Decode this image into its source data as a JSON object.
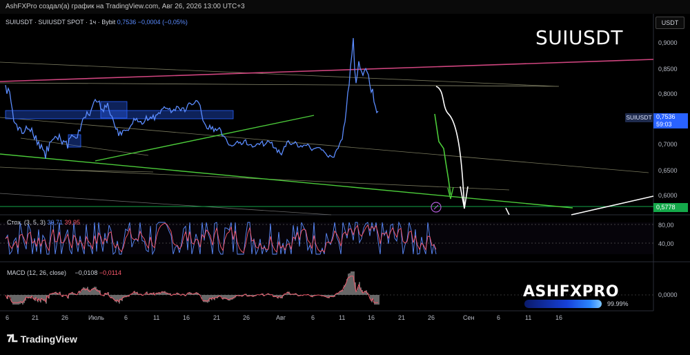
{
  "header": {
    "publish_info": "AshFXPro создал(а) график на TradingView.com, Авг 26, 2026 13:00 UTC+3"
  },
  "legend": {
    "symbol_line": "SUIUSDT · SUIUSDT SPOT · 1ч · Bybit",
    "last": "0,7536",
    "change": "−0,0004 (−0,05%)"
  },
  "symbol_title": "SUIUSDT",
  "currency_button": "USDT",
  "price_tag": {
    "symbol": "SUIUSDT",
    "price": "0,7536",
    "countdown": "59:03"
  },
  "green_tag": "0,5778",
  "stoch_legend": {
    "name": "Стох. (3, 5, 3)",
    "k": "30,71",
    "d": "39,95"
  },
  "macd_legend": {
    "name": "MACD (12, 26, close)",
    "macd": "−0,0108",
    "signal": "−0,0114"
  },
  "brand": {
    "name": "ASHFXPRO",
    "percent": "99.99%"
  },
  "footer": {
    "logo_text": "TradingView"
  },
  "colors": {
    "price_line": "#5b8cff",
    "accent_blue": "#2962ff",
    "green_level": "#14a84a",
    "trend_green": "#4ccc3a",
    "magenta_line": "#d0457f",
    "stoch_k": "#5b8cff",
    "stoch_d": "#ff5a6e",
    "macd_hist": "#8a8a8a"
  },
  "chart_data": [
    {
      "type": "line",
      "name": "price",
      "series_name": "SUIUSDT",
      "price_axis_ticks": [
        "0,9000",
        "0,8500",
        "0,8000",
        "0,7500",
        "0,7000",
        "0,6500",
        "0,6000"
      ],
      "ylim": [
        0.57,
        0.955
      ],
      "time_axis_labels": [
        "6",
        "21",
        "26",
        "Июль",
        "6",
        "11",
        "16",
        "21",
        "26",
        "Авг",
        "6",
        "11",
        "16",
        "21",
        "26",
        "Сен",
        "6",
        "11",
        "16"
      ],
      "x": [
        0,
        2,
        4,
        6,
        8,
        10,
        12,
        14,
        16,
        18,
        20,
        22,
        24,
        26,
        28,
        30,
        32,
        34,
        36,
        38,
        40,
        42,
        44,
        46,
        48,
        50,
        52,
        54,
        56,
        58,
        60,
        62,
        64,
        66,
        68,
        70,
        72,
        74,
        76,
        78,
        80,
        82,
        84,
        86,
        88,
        90,
        92,
        94,
        96,
        98,
        100,
        102,
        104,
        106,
        108,
        110,
        112,
        114,
        116,
        118,
        120,
        122,
        124,
        126,
        128,
        130,
        132,
        134,
        136,
        138,
        140,
        142,
        144,
        146,
        148,
        150,
        152,
        154,
        156,
        158,
        160,
        162,
        164,
        166,
        168,
        170,
        172,
        174,
        176,
        178,
        180,
        182,
        184,
        186,
        188,
        190,
        192,
        194,
        196,
        198,
        200,
        202,
        204,
        206,
        208,
        210,
        212,
        214,
        216,
        218,
        220,
        222,
        224,
        226,
        228,
        230,
        232,
        234,
        236,
        238,
        240,
        242,
        244,
        246,
        248,
        250,
        252,
        254,
        256,
        258,
        260,
        262,
        264,
        266,
        268,
        270,
        272,
        274,
        276,
        278,
        280,
        282,
        284,
        286,
        288,
        290,
        292,
        294,
        296,
        298,
        300,
        302,
        304,
        306,
        308,
        310,
        312,
        314,
        316,
        318,
        320,
        322,
        324,
        326,
        328,
        330,
        332,
        334,
        336,
        338,
        340,
        342,
        344,
        346,
        348,
        350,
        352,
        354,
        356,
        358,
        360,
        362,
        364,
        366,
        368,
        370,
        372,
        374,
        376,
        378,
        380,
        382,
        384,
        386,
        388,
        390,
        392,
        394,
        396,
        398,
        400,
        402,
        404,
        406,
        408,
        410,
        412,
        414,
        416,
        418,
        420,
        422,
        424,
        426,
        428,
        430,
        432,
        434,
        436,
        438,
        440,
        442,
        444,
        446,
        448,
        450,
        452,
        454,
        456,
        458,
        460,
        462,
        464,
        466,
        468,
        470,
        472,
        474,
        476,
        478,
        480,
        482,
        484,
        486,
        488,
        490,
        492,
        494,
        496,
        498,
        500,
        502,
        504,
        506,
        508,
        510,
        512,
        514,
        516,
        518,
        520,
        522,
        524,
        526,
        528,
        530,
        532,
        534,
        536,
        538,
        540,
        542,
        544,
        546,
        548,
        550,
        552,
        554,
        556,
        558,
        560,
        562,
        564,
        566,
        568,
        570,
        572,
        574,
        576,
        578,
        580,
        582,
        584,
        586,
        588,
        590,
        592,
        594,
        596,
        598,
        600,
        602,
        604,
        606,
        608,
        610,
        612,
        614,
        616,
        618,
        620,
        622,
        624,
        626,
        628,
        630
      ],
      "values": [
        0.808,
        0.79,
        0.801,
        0.794,
        0.773,
        0.756,
        0.733,
        0.729,
        0.727,
        0.715,
        0.721,
        0.719,
        0.708,
        0.708,
        0.713,
        0.723,
        0.717,
        0.717,
        0.712,
        0.719,
        0.706,
        0.696,
        0.704,
        0.685,
        0.691,
        0.676,
        0.685,
        0.675,
        0.672,
        0.656,
        0.682,
        0.671,
        0.69,
        0.691,
        0.695,
        0.697,
        0.702,
        0.7,
        0.695,
        0.706,
        0.695,
        0.686,
        0.693,
        0.69,
        0.692,
        0.677,
        0.697,
        0.699,
        0.705,
        0.702,
        0.701,
        0.698,
        0.699,
        0.715,
        0.713,
        0.727,
        0.738,
        0.741,
        0.741,
        0.753,
        0.747,
        0.745,
        0.756,
        0.764,
        0.773,
        0.778,
        0.773,
        0.773,
        0.775,
        0.758,
        0.758,
        0.753,
        0.766,
        0.762,
        0.771,
        0.756,
        0.746,
        0.744,
        0.736,
        0.725,
        0.717,
        0.718,
        0.703,
        0.712,
        0.705,
        0.714,
        0.715,
        0.714,
        0.715,
        0.714,
        0.72,
        0.725,
        0.728,
        0.739,
        0.735,
        0.739,
        0.732,
        0.732,
        0.733,
        0.727,
        0.729,
        0.734,
        0.744,
        0.735,
        0.737,
        0.742,
        0.739,
        0.746,
        0.736,
        0.746,
        0.747,
        0.751,
        0.749,
        0.758,
        0.759,
        0.763,
        0.76,
        0.76,
        0.758,
        0.76,
        0.751,
        0.754,
        0.758,
        0.755,
        0.764,
        0.763,
        0.759,
        0.755,
        0.761,
        0.761,
        0.753,
        0.758,
        0.767,
        0.771,
        0.77,
        0.767,
        0.768,
        0.771,
        0.776,
        0.775,
        0.771,
        0.766,
        0.75,
        0.735,
        0.73,
        0.725,
        0.718,
        0.717,
        0.725,
        0.717,
        0.722,
        0.712,
        0.718,
        0.714,
        0.717,
        0.72,
        0.715,
        0.703,
        0.703,
        0.7,
        0.696,
        0.688,
        0.684,
        0.684,
        0.682,
        0.683,
        0.685,
        0.689,
        0.692,
        0.688,
        0.69,
        0.685,
        0.687,
        0.693,
        0.695,
        0.685,
        0.684,
        0.685,
        0.685,
        0.68,
        0.681,
        0.682,
        0.686,
        0.687,
        0.685,
        0.689,
        0.692,
        0.682,
        0.685,
        0.688,
        0.693,
        0.691,
        0.688,
        0.69,
        0.679,
        0.678,
        0.678,
        0.669,
        0.674,
        0.667,
        0.664,
        0.672,
        0.681,
        0.681,
        0.691,
        0.693,
        0.687,
        0.685,
        0.687,
        0.687,
        0.691,
        0.687,
        0.68,
        0.68,
        0.683,
        0.68,
        0.684,
        0.684,
        0.683,
        0.686,
        0.683,
        0.677,
        0.673,
        0.676,
        0.677,
        0.678,
        0.679,
        0.679,
        0.678,
        0.674,
        0.674,
        0.67,
        0.667,
        0.662,
        0.659,
        0.663,
        0.661,
        0.659,
        0.659,
        0.669,
        0.675,
        0.677,
        0.686,
        0.693,
        0.696,
        0.72,
        0.732,
        0.759,
        0.792,
        0.808,
        0.847,
        0.871,
        0.905,
        0.84,
        0.812,
        0.831,
        0.857,
        0.842,
        0.836,
        0.828,
        0.837,
        0.842,
        0.835,
        0.829,
        0.808,
        0.793,
        0.8,
        0.773,
        0.764,
        0.751,
        0.754
      ]
    },
    {
      "type": "line",
      "name": "stochastic",
      "ylim": [
        0,
        100
      ],
      "axis_ticks": [
        "80,00",
        "40,00"
      ],
      "series": [
        {
          "name": "%K"
        },
        {
          "name": "%D"
        }
      ]
    },
    {
      "type": "bar",
      "name": "macd",
      "axis_ticks": [
        "0,0000"
      ]
    }
  ]
}
